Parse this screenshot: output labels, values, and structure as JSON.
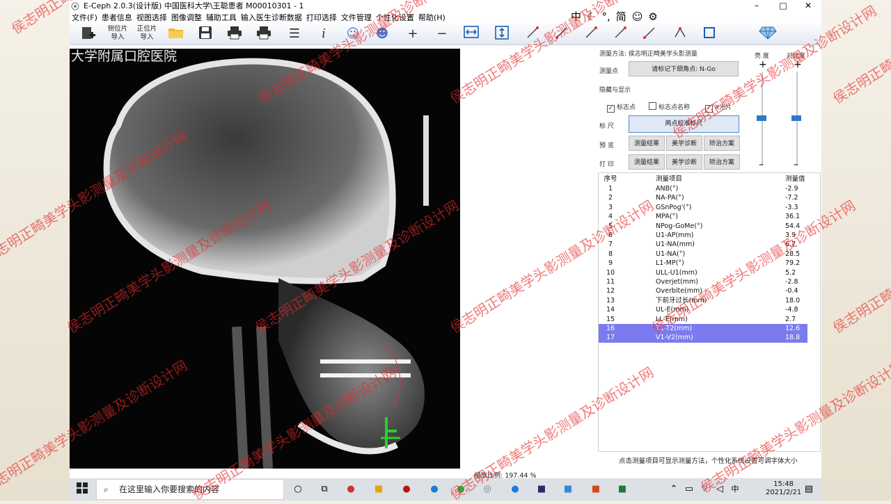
{
  "window": {
    "title": "E-Ceph 2.0.3(设计版)   中国医科大学\\王聪患者   M00010301  -  1",
    "minimize": "–",
    "maximize": "□",
    "close": "✕"
  },
  "menu": {
    "items": [
      "文件(F)",
      "患者信息",
      "视图选择",
      "图像调整",
      "辅助工具",
      "输入医生诊断数据",
      "打印选择",
      "文件管理",
      "个性化设置",
      "帮助(H)"
    ],
    "quick": [
      "中",
      "☾",
      "°,",
      "简",
      "☺",
      "⚙"
    ]
  },
  "toolbar": {
    "btn_lateral_1": "侧位片",
    "btn_lateral_2": "导入",
    "btn_frontal_1": "正位片",
    "btn_frontal_2": "导入"
  },
  "xray": {
    "watermark_text": "大学附属口腔医院"
  },
  "panel": {
    "method_label": "测量方法: 侯志明正畸美学头影测量",
    "point_label": "测量点",
    "point_value": "请标记下颌角点: N-Go",
    "hide_show_label": "隐藏与显示",
    "chk_landmark": "标志点",
    "chk_landmark_name": "标志点名称",
    "chk_xray": "X光片",
    "ruler_label": "标    尺",
    "ruler_btn": "两点校准标尺",
    "preview_label": "预    览",
    "print_label": "打    印",
    "btn_results": "测量结果",
    "btn_aesthetic": "美学诊断",
    "btn_plan": "矫治方案",
    "brightness_label": "亮 度",
    "contrast_label": "对比度",
    "plus": "+",
    "minus": "–",
    "brightness_level": 0.5,
    "contrast_level": 0.5
  },
  "table": {
    "headers": [
      "序号",
      "测量项目",
      "测量值"
    ],
    "rows": [
      [
        "1",
        "ANB(°)",
        "-2.9"
      ],
      [
        "2",
        "NA-PA(°)",
        "-7.2"
      ],
      [
        "3",
        "GSnPog'(°)",
        "-3.3"
      ],
      [
        "4",
        "MPA(°)",
        "36.1"
      ],
      [
        "5",
        "NPog-GoMe(°)",
        "54.4"
      ],
      [
        "6",
        "U1-AP(mm)",
        "3.9"
      ],
      [
        "7",
        "U1-NA(mm)",
        "6.7"
      ],
      [
        "8",
        "U1-NA(°)",
        "28.5"
      ],
      [
        "9",
        "L1-MP(°)",
        "79.2"
      ],
      [
        "10",
        "ULL-U1(mm)",
        "5.2"
      ],
      [
        "11",
        "Overjet(mm)",
        "-2.8"
      ],
      [
        "12",
        "Overbite(mm)",
        "-0.4"
      ],
      [
        "13",
        "下前牙过长(mm)",
        "18.0"
      ],
      [
        "14",
        "UL-E(mm)",
        "-4.8"
      ],
      [
        "15",
        "LL-E(mm)",
        "2.7"
      ],
      [
        "16",
        "T1-T2(mm)",
        "12.6"
      ],
      [
        "17",
        "V1-V2(mm)",
        "18.8"
      ]
    ],
    "selected_rows": [
      16,
      17
    ]
  },
  "status": {
    "zoom": "缩放比例: 197.44 %",
    "hint": "点击测量项目可显示测量方法，个性化系统设置可调字体大小"
  },
  "taskbar": {
    "search_placeholder": "在这里输入你要搜索的内容",
    "time": "15:48",
    "date": "2021/2/21",
    "ime": "中"
  },
  "watermarks": [
    "侯志明正畸美学头影测量及诊断设计网"
  ]
}
